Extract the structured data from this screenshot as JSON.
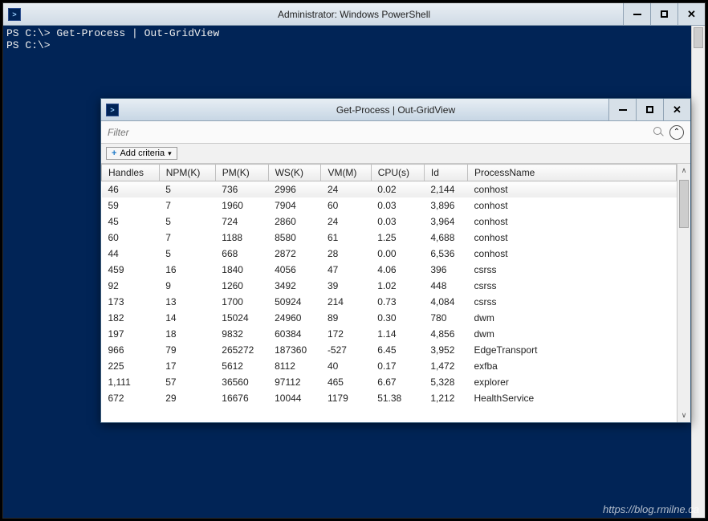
{
  "ps_window": {
    "title": "Administrator: Windows PowerShell",
    "console_lines": [
      "PS C:\\> Get-Process | Out-GridView",
      "PS C:\\>"
    ]
  },
  "grid_window": {
    "title": "Get-Process | Out-GridView",
    "filter_placeholder": "Filter",
    "add_criteria_label": "Add criteria",
    "columns": [
      "Handles",
      "NPM(K)",
      "PM(K)",
      "WS(K)",
      "VM(M)",
      "CPU(s)",
      "Id",
      "ProcessName"
    ],
    "rows": [
      {
        "Handles": "46",
        "NPM": "5",
        "PM": "736",
        "WS": "2996",
        "VM": "24",
        "CPU": "0.02",
        "Id": "2,144",
        "Name": "conhost"
      },
      {
        "Handles": "59",
        "NPM": "7",
        "PM": "1960",
        "WS": "7904",
        "VM": "60",
        "CPU": "0.03",
        "Id": "3,896",
        "Name": "conhost"
      },
      {
        "Handles": "45",
        "NPM": "5",
        "PM": "724",
        "WS": "2860",
        "VM": "24",
        "CPU": "0.03",
        "Id": "3,964",
        "Name": "conhost"
      },
      {
        "Handles": "60",
        "NPM": "7",
        "PM": "1188",
        "WS": "8580",
        "VM": "61",
        "CPU": "1.25",
        "Id": "4,688",
        "Name": "conhost"
      },
      {
        "Handles": "44",
        "NPM": "5",
        "PM": "668",
        "WS": "2872",
        "VM": "28",
        "CPU": "0.00",
        "Id": "6,536",
        "Name": "conhost"
      },
      {
        "Handles": "459",
        "NPM": "16",
        "PM": "1840",
        "WS": "4056",
        "VM": "47",
        "CPU": "4.06",
        "Id": "396",
        "Name": "csrss"
      },
      {
        "Handles": "92",
        "NPM": "9",
        "PM": "1260",
        "WS": "3492",
        "VM": "39",
        "CPU": "1.02",
        "Id": "448",
        "Name": "csrss"
      },
      {
        "Handles": "173",
        "NPM": "13",
        "PM": "1700",
        "WS": "50924",
        "VM": "214",
        "CPU": "0.73",
        "Id": "4,084",
        "Name": "csrss"
      },
      {
        "Handles": "182",
        "NPM": "14",
        "PM": "15024",
        "WS": "24960",
        "VM": "89",
        "CPU": "0.30",
        "Id": "780",
        "Name": "dwm"
      },
      {
        "Handles": "197",
        "NPM": "18",
        "PM": "9832",
        "WS": "60384",
        "VM": "172",
        "CPU": "1.14",
        "Id": "4,856",
        "Name": "dwm"
      },
      {
        "Handles": "966",
        "NPM": "79",
        "PM": "265272",
        "WS": "187360",
        "VM": "-527",
        "CPU": "6.45",
        "Id": "3,952",
        "Name": "EdgeTransport"
      },
      {
        "Handles": "225",
        "NPM": "17",
        "PM": "5612",
        "WS": "8112",
        "VM": "40",
        "CPU": "0.17",
        "Id": "1,472",
        "Name": "exfba"
      },
      {
        "Handles": "1,111",
        "NPM": "57",
        "PM": "36560",
        "WS": "97112",
        "VM": "465",
        "CPU": "6.67",
        "Id": "5,328",
        "Name": "explorer"
      },
      {
        "Handles": "672",
        "NPM": "29",
        "PM": "16676",
        "WS": "10044",
        "VM": "1179",
        "CPU": "51.38",
        "Id": "1,212",
        "Name": "HealthService"
      }
    ]
  },
  "watermark": "https://blog.rmilne.ca"
}
